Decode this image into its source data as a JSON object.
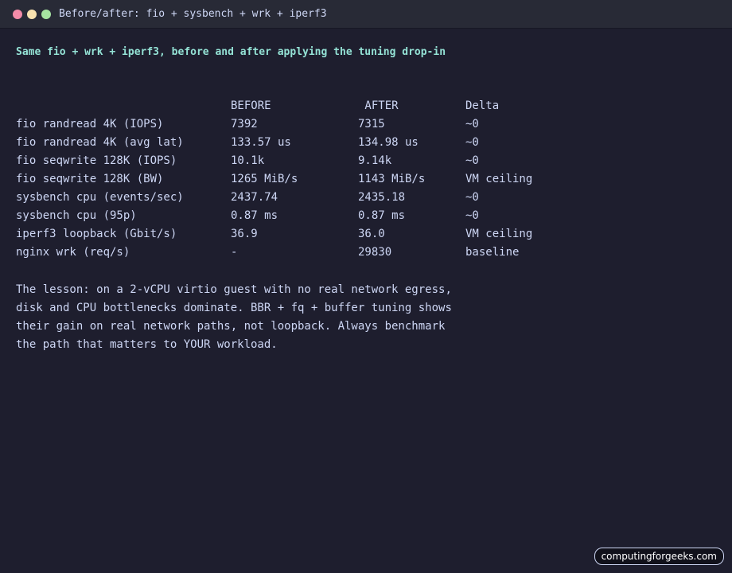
{
  "window": {
    "title": "Before/after: fio + sysbench + wrk + iperf3",
    "buttons": {
      "close_color": "#f38ba8",
      "minimize_color": "#f9e2af",
      "maximize_color": "#a6e3a1"
    }
  },
  "terminal": {
    "heading": "Same fio + wrk + iperf3, before and after applying the tuning drop-in",
    "table": {
      "headers": [
        "",
        "BEFORE",
        " AFTER",
        "Delta"
      ],
      "rows": [
        [
          "fio randread 4K (IOPS)",
          "7392",
          "7315",
          "~0"
        ],
        [
          "fio randread 4K (avg lat)",
          "133.57 us",
          "134.98 us",
          "~0"
        ],
        [
          "fio seqwrite 128K (IOPS)",
          "10.1k",
          "9.14k",
          "~0"
        ],
        [
          "fio seqwrite 128K (BW)",
          "1265 MiB/s",
          "1143 MiB/s",
          "VM ceiling"
        ],
        [
          "sysbench cpu (events/sec)",
          "2437.74",
          "2435.18",
          "~0"
        ],
        [
          "sysbench cpu (95p)",
          "0.87 ms",
          "0.87 ms",
          "~0"
        ],
        [
          "iperf3 loopback (Gbit/s)",
          "36.9",
          "36.0",
          "VM ceiling"
        ],
        [
          "nginx wrk (req/s)",
          "-",
          "29830",
          "baseline"
        ]
      ]
    },
    "lesson": [
      "The lesson: on a 2-vCPU virtio guest with no real network egress,",
      "disk and CPU bottlenecks dominate. BBR + fq + buffer tuning shows",
      "their gain on real network paths, not loopback. Always benchmark",
      "the path that matters to YOUR workload."
    ]
  },
  "watermark": "computingforgeeks.com"
}
